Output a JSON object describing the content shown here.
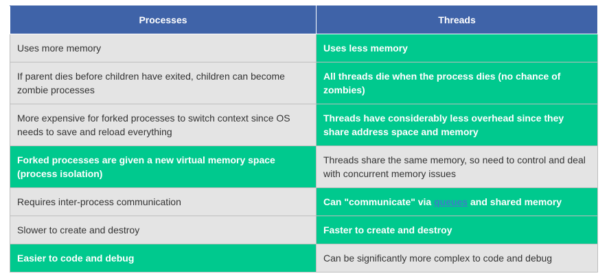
{
  "table": {
    "headers": [
      "Processes",
      "Threads"
    ],
    "rows": [
      {
        "processes": "Uses more memory",
        "threads": "Uses less memory",
        "advantage": "threads"
      },
      {
        "processes": "If parent dies before children have exited, children can become zombie processes",
        "threads": "All threads die when the process dies (no chance of zombies)",
        "advantage": "threads"
      },
      {
        "processes": "More expensive for forked processes to switch context since OS needs to save and reload everything",
        "threads": "Threads have considerably less overhead since they share address space and memory",
        "advantage": "threads"
      },
      {
        "processes": "Forked processes are given a new virtual memory space (process isolation)",
        "threads": "Threads share the same memory, so need to control and deal with concurrent memory issues",
        "advantage": "processes"
      },
      {
        "processes": "Requires inter-process communication",
        "threads_before": "Can \"communicate\" via ",
        "threads_link": "queues",
        "threads_after": " and shared memory",
        "advantage": "threads"
      },
      {
        "processes": "Slower to create and destroy",
        "threads": "Faster to create and destroy",
        "advantage": "threads"
      },
      {
        "processes": "Easier to code and debug",
        "threads": "Can be significantly more complex to code and debug",
        "advantage": "processes"
      }
    ]
  },
  "colors": {
    "header_bg": "#3f63a8",
    "advantage_bg": "#00c98e",
    "plain_bg": "#e4e4e4",
    "link": "#3c7fc4"
  }
}
